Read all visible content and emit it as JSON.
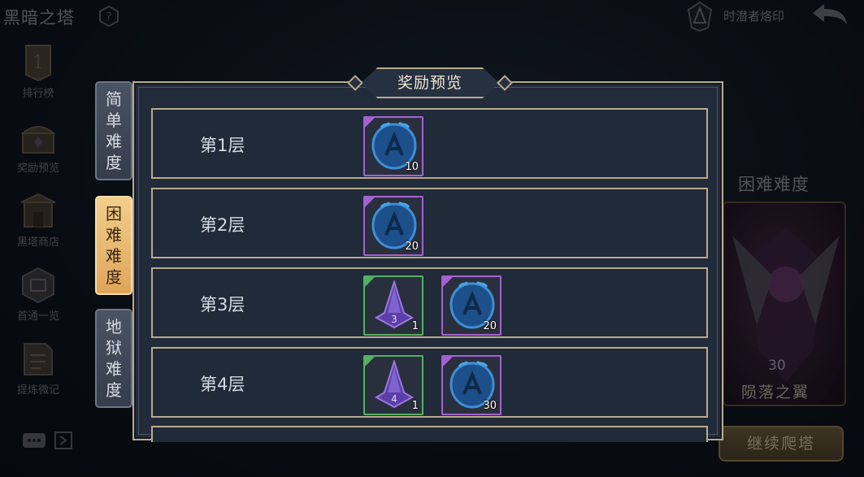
{
  "header": {
    "title": "黑暗之塔",
    "seal_label": "时潜者烙印"
  },
  "sidebar": {
    "items": [
      {
        "label": "排行榜",
        "icon": "rank-icon"
      },
      {
        "label": "奖励预览",
        "icon": "chest-icon"
      },
      {
        "label": "黑塔商店",
        "icon": "shop-icon"
      },
      {
        "label": "首通一览",
        "icon": "first-clear-icon"
      },
      {
        "label": "提炼微记",
        "icon": "note-icon"
      }
    ],
    "rank_badge": "1"
  },
  "difficulty_tabs": [
    {
      "label": [
        "简",
        "单",
        "难",
        "度"
      ],
      "active": false
    },
    {
      "label": [
        "困",
        "难",
        "难",
        "度"
      ],
      "active": true
    },
    {
      "label": [
        "地",
        "狱",
        "难",
        "度"
      ],
      "active": false
    }
  ],
  "background": {
    "difficulty_label": "困难难度",
    "hero_level": "30",
    "hero_name": "陨落之翼",
    "continue_label": "继续爬塔"
  },
  "modal": {
    "title": "奖励预览",
    "rows": [
      {
        "floor": "第1层",
        "rewards": [
          {
            "type": "blue-seal",
            "rarity": "purple",
            "qty": "10"
          }
        ]
      },
      {
        "floor": "第2层",
        "rewards": [
          {
            "type": "blue-seal",
            "rarity": "purple",
            "qty": "20"
          }
        ]
      },
      {
        "floor": "第3层",
        "rewards": [
          {
            "type": "tower-token",
            "rarity": "green",
            "qty": "1",
            "numeral": "3"
          },
          {
            "type": "blue-seal",
            "rarity": "purple",
            "qty": "20"
          }
        ]
      },
      {
        "floor": "第4层",
        "rewards": [
          {
            "type": "tower-token",
            "rarity": "green",
            "qty": "1",
            "numeral": "4"
          },
          {
            "type": "blue-seal",
            "rarity": "purple",
            "qty": "30"
          }
        ]
      }
    ]
  },
  "colors": {
    "frame_gold": "#b8ab8c",
    "rarity_purple": "#a461d2",
    "rarity_green": "#52b262",
    "tab_active": "#e8b86e",
    "panel_bg": "#222b3a"
  }
}
